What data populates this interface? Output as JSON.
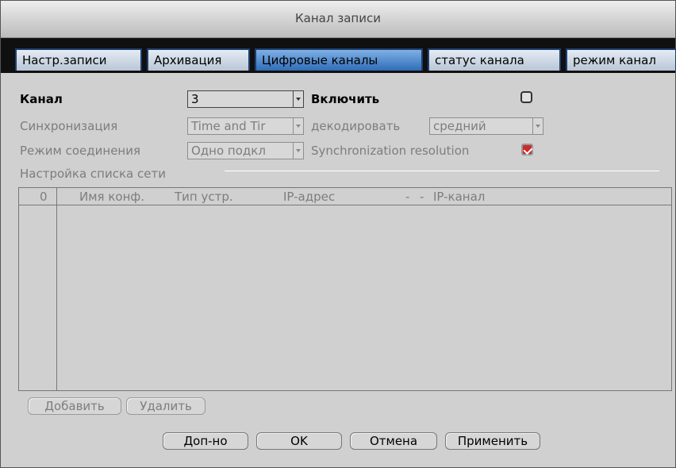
{
  "window": {
    "title": "Канал записи"
  },
  "tabs": [
    {
      "label": "Настр.записи",
      "active": false
    },
    {
      "label": "Архивация",
      "active": false
    },
    {
      "label": "Цифровые каналы",
      "active": true
    },
    {
      "label": "статус канала",
      "active": false
    },
    {
      "label": "режим канал",
      "active": false
    }
  ],
  "form": {
    "channel": {
      "label": "Канал",
      "value": "3"
    },
    "enable": {
      "label": "Включить",
      "checked": false
    },
    "sync": {
      "label": "Синхронизация",
      "value": "Time and Tir"
    },
    "decode": {
      "label": "декодировать",
      "value": "средний"
    },
    "conn_mode": {
      "label": "Режим соединения",
      "value": "Одно подкл"
    },
    "sync_res": {
      "label": "Synchronization resolution",
      "checked": true
    }
  },
  "network_list": {
    "section_label": "Настройка списка сети",
    "columns": [
      "0",
      "Имя конф.",
      "Тип устр.",
      "IP-адрес",
      "-",
      "-",
      "IP-канал"
    ],
    "rows": []
  },
  "list_buttons": {
    "add": "Добавить",
    "delete": "Удалить"
  },
  "footer_buttons": {
    "advanced": "Доп-но",
    "ok": "OK",
    "cancel": "Отмена",
    "apply": "Применить"
  }
}
